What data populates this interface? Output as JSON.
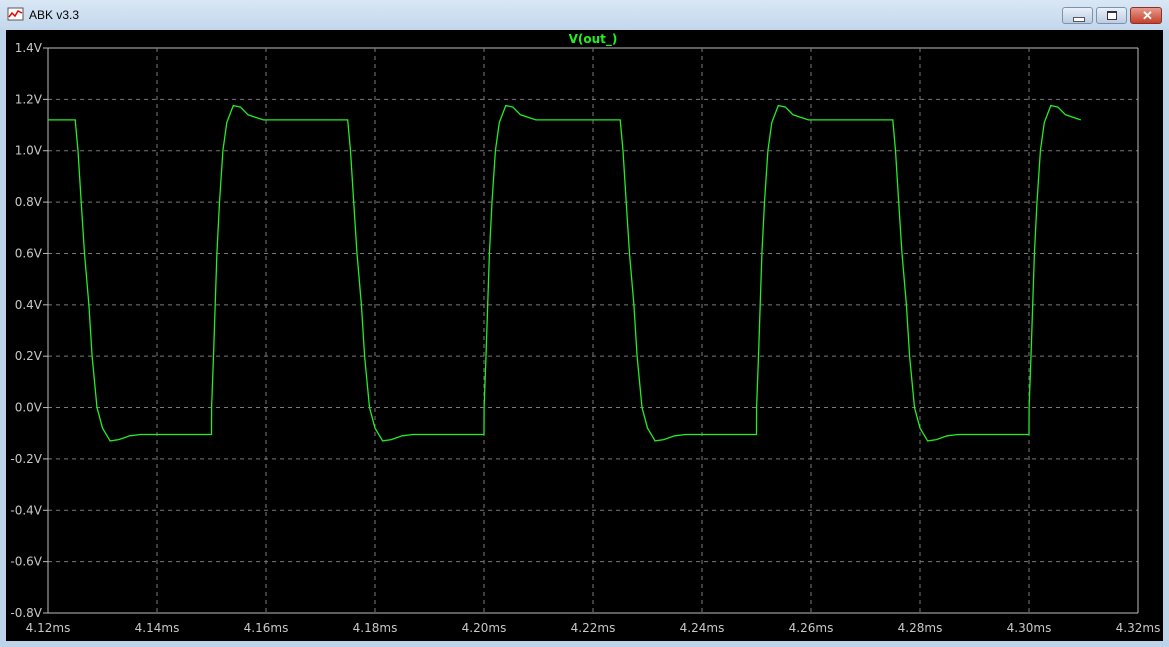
{
  "window": {
    "title": "ABK v3.3",
    "icon": "waveform-app-icon",
    "controls": [
      "minimize-icon",
      "maximize-icon",
      "close-icon"
    ]
  },
  "colors": {
    "trace": "#22ee22",
    "background": "#000000",
    "grid": "#7a7a7a",
    "axis": "#bdbdbd"
  },
  "chart_data": {
    "type": "line",
    "title": "V(out_)",
    "xlabel": "",
    "ylabel": "",
    "xlim": [
      4.12,
      4.32
    ],
    "ylim": [
      -0.8,
      1.4
    ],
    "grid": true,
    "x_ticks": [
      "4.12ms",
      "4.14ms",
      "4.16ms",
      "4.18ms",
      "4.20ms",
      "4.22ms",
      "4.24ms",
      "4.26ms",
      "4.28ms",
      "4.30ms",
      "4.32ms"
    ],
    "x_tick_values": [
      4.12,
      4.14,
      4.16,
      4.18,
      4.2,
      4.22,
      4.24,
      4.26,
      4.28,
      4.3,
      4.32
    ],
    "y_ticks": [
      "1.4V",
      "1.2V",
      "1.0V",
      "0.8V",
      "0.6V",
      "0.4V",
      "0.2V",
      "0.0V",
      "-0.2V",
      "-0.4V",
      "-0.6V",
      "-0.8V"
    ],
    "y_tick_values": [
      1.4,
      1.2,
      1.0,
      0.8,
      0.6,
      0.4,
      0.2,
      0.0,
      -0.2,
      -0.4,
      -0.6,
      -0.8
    ],
    "series": [
      {
        "name": "V(out_)",
        "period_ms": 0.05,
        "cycle_starts_ms": [
          4.075,
          4.125,
          4.175,
          4.225,
          4.275
        ],
        "cycle_points": [
          [
            0,
            1.12
          ],
          [
            0.0005,
            1.0
          ],
          [
            0.0011,
            0.8
          ],
          [
            0.0017,
            0.6
          ],
          [
            0.0025,
            0.4
          ],
          [
            0.0031,
            0.2
          ],
          [
            0.004,
            0.0
          ],
          [
            0.005,
            -0.08
          ],
          [
            0.0064,
            -0.13
          ],
          [
            0.008,
            -0.125
          ],
          [
            0.01,
            -0.11
          ],
          [
            0.012,
            -0.105
          ],
          [
            0.025,
            -0.105
          ],
          [
            0.02501,
            0.0
          ],
          [
            0.02537,
            0.2
          ],
          [
            0.02568,
            0.4
          ],
          [
            0.02599,
            0.6
          ],
          [
            0.02647,
            0.8
          ],
          [
            0.0271,
            1.0
          ],
          [
            0.0278,
            1.11
          ],
          [
            0.029,
            1.176
          ],
          [
            0.0303,
            1.17
          ],
          [
            0.0317,
            1.14
          ],
          [
            0.0345,
            1.12
          ],
          [
            0.05,
            1.12
          ]
        ]
      }
    ]
  }
}
